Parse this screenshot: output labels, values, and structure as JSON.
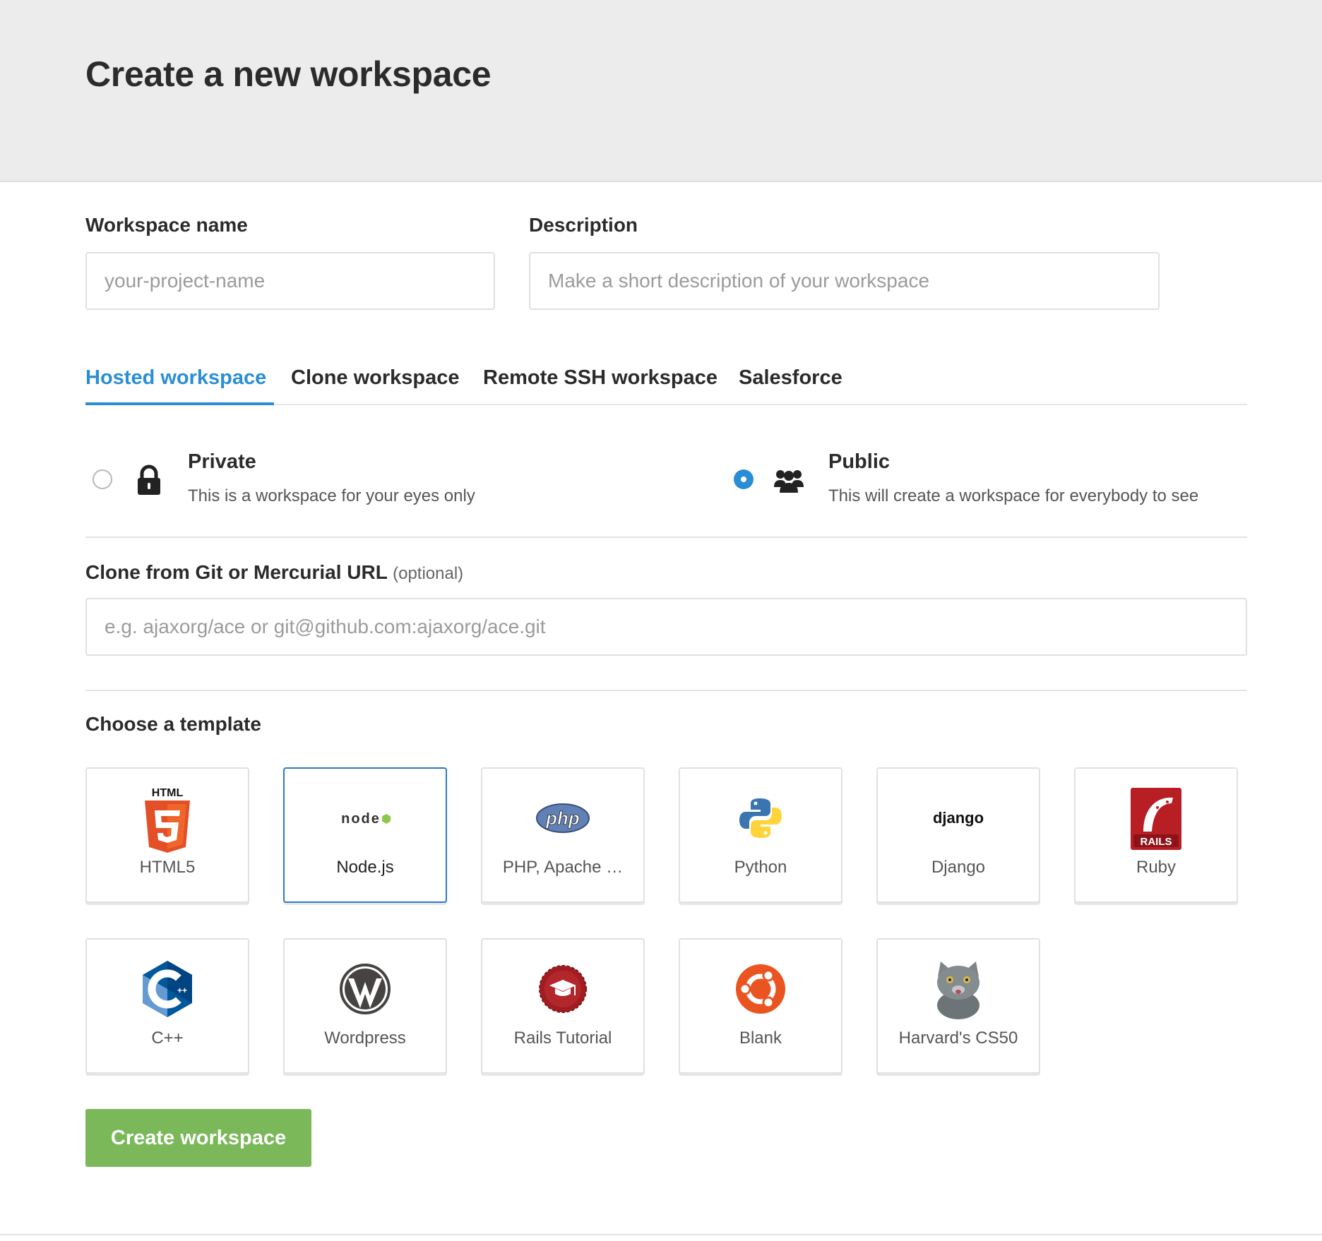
{
  "page": {
    "title": "Create a new workspace"
  },
  "form": {
    "workspace_name": {
      "label": "Workspace name",
      "placeholder": "your-project-name",
      "value": ""
    },
    "description": {
      "label": "Description",
      "placeholder": "Make a short description of your workspace",
      "value": ""
    }
  },
  "tabs": [
    {
      "label": "Hosted workspace",
      "active": true
    },
    {
      "label": "Clone workspace",
      "active": false
    },
    {
      "label": "Remote SSH workspace",
      "active": false
    },
    {
      "label": "Salesforce",
      "active": false
    }
  ],
  "visibility": {
    "selected": "public",
    "private": {
      "title": "Private",
      "description": "This is a workspace for your eyes only",
      "icon": "lock-icon"
    },
    "public": {
      "title": "Public",
      "description": "This will create a workspace for everybody to see",
      "icon": "users-icon"
    }
  },
  "clone": {
    "label": "Clone from Git or Mercurial URL",
    "optional": "(optional)",
    "placeholder": "e.g. ajaxorg/ace or git@github.com:ajaxorg/ace.git",
    "value": ""
  },
  "templates": {
    "heading": "Choose a template",
    "selected": "Node.js",
    "items": [
      {
        "label": "HTML5",
        "icon": "html5-icon"
      },
      {
        "label": "Node.js",
        "icon": "nodejs-icon"
      },
      {
        "label": "PHP, Apache …",
        "icon": "php-icon"
      },
      {
        "label": "Python",
        "icon": "python-icon"
      },
      {
        "label": "Django",
        "icon": "django-icon"
      },
      {
        "label": "Ruby",
        "icon": "rails-icon"
      },
      {
        "label": "C++",
        "icon": "cpp-icon"
      },
      {
        "label": "Wordpress",
        "icon": "wordpress-icon"
      },
      {
        "label": "Rails Tutorial",
        "icon": "rails-tutorial-icon"
      },
      {
        "label": "Blank",
        "icon": "ubuntu-icon"
      },
      {
        "label": "Harvard's CS50",
        "icon": "cat-icon"
      }
    ]
  },
  "logo_text": {
    "html": "HTML",
    "node": "node",
    "php": "php",
    "django": "django",
    "rails": "RAILS"
  },
  "colors": {
    "accent": "#2a8ed6",
    "create_button": "#7ab85a",
    "header_bg": "#ececec"
  },
  "actions": {
    "create_label": "Create workspace"
  }
}
